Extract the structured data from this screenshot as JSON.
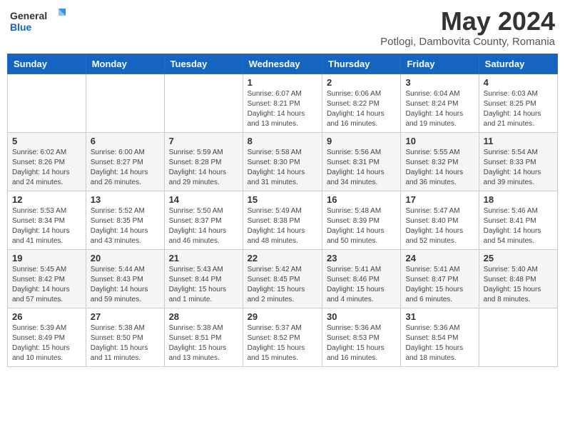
{
  "header": {
    "logo_general": "General",
    "logo_blue": "Blue",
    "month_title": "May 2024",
    "subtitle": "Potlogi, Dambovita County, Romania"
  },
  "weekdays": [
    "Sunday",
    "Monday",
    "Tuesday",
    "Wednesday",
    "Thursday",
    "Friday",
    "Saturday"
  ],
  "weeks": [
    [
      {
        "day": "",
        "detail": ""
      },
      {
        "day": "",
        "detail": ""
      },
      {
        "day": "",
        "detail": ""
      },
      {
        "day": "1",
        "detail": "Sunrise: 6:07 AM\nSunset: 8:21 PM\nDaylight: 14 hours\nand 13 minutes."
      },
      {
        "day": "2",
        "detail": "Sunrise: 6:06 AM\nSunset: 8:22 PM\nDaylight: 14 hours\nand 16 minutes."
      },
      {
        "day": "3",
        "detail": "Sunrise: 6:04 AM\nSunset: 8:24 PM\nDaylight: 14 hours\nand 19 minutes."
      },
      {
        "day": "4",
        "detail": "Sunrise: 6:03 AM\nSunset: 8:25 PM\nDaylight: 14 hours\nand 21 minutes."
      }
    ],
    [
      {
        "day": "5",
        "detail": "Sunrise: 6:02 AM\nSunset: 8:26 PM\nDaylight: 14 hours\nand 24 minutes."
      },
      {
        "day": "6",
        "detail": "Sunrise: 6:00 AM\nSunset: 8:27 PM\nDaylight: 14 hours\nand 26 minutes."
      },
      {
        "day": "7",
        "detail": "Sunrise: 5:59 AM\nSunset: 8:28 PM\nDaylight: 14 hours\nand 29 minutes."
      },
      {
        "day": "8",
        "detail": "Sunrise: 5:58 AM\nSunset: 8:30 PM\nDaylight: 14 hours\nand 31 minutes."
      },
      {
        "day": "9",
        "detail": "Sunrise: 5:56 AM\nSunset: 8:31 PM\nDaylight: 14 hours\nand 34 minutes."
      },
      {
        "day": "10",
        "detail": "Sunrise: 5:55 AM\nSunset: 8:32 PM\nDaylight: 14 hours\nand 36 minutes."
      },
      {
        "day": "11",
        "detail": "Sunrise: 5:54 AM\nSunset: 8:33 PM\nDaylight: 14 hours\nand 39 minutes."
      }
    ],
    [
      {
        "day": "12",
        "detail": "Sunrise: 5:53 AM\nSunset: 8:34 PM\nDaylight: 14 hours\nand 41 minutes."
      },
      {
        "day": "13",
        "detail": "Sunrise: 5:52 AM\nSunset: 8:35 PM\nDaylight: 14 hours\nand 43 minutes."
      },
      {
        "day": "14",
        "detail": "Sunrise: 5:50 AM\nSunset: 8:37 PM\nDaylight: 14 hours\nand 46 minutes."
      },
      {
        "day": "15",
        "detail": "Sunrise: 5:49 AM\nSunset: 8:38 PM\nDaylight: 14 hours\nand 48 minutes."
      },
      {
        "day": "16",
        "detail": "Sunrise: 5:48 AM\nSunset: 8:39 PM\nDaylight: 14 hours\nand 50 minutes."
      },
      {
        "day": "17",
        "detail": "Sunrise: 5:47 AM\nSunset: 8:40 PM\nDaylight: 14 hours\nand 52 minutes."
      },
      {
        "day": "18",
        "detail": "Sunrise: 5:46 AM\nSunset: 8:41 PM\nDaylight: 14 hours\nand 54 minutes."
      }
    ],
    [
      {
        "day": "19",
        "detail": "Sunrise: 5:45 AM\nSunset: 8:42 PM\nDaylight: 14 hours\nand 57 minutes."
      },
      {
        "day": "20",
        "detail": "Sunrise: 5:44 AM\nSunset: 8:43 PM\nDaylight: 14 hours\nand 59 minutes."
      },
      {
        "day": "21",
        "detail": "Sunrise: 5:43 AM\nSunset: 8:44 PM\nDaylight: 15 hours\nand 1 minute."
      },
      {
        "day": "22",
        "detail": "Sunrise: 5:42 AM\nSunset: 8:45 PM\nDaylight: 15 hours\nand 2 minutes."
      },
      {
        "day": "23",
        "detail": "Sunrise: 5:41 AM\nSunset: 8:46 PM\nDaylight: 15 hours\nand 4 minutes."
      },
      {
        "day": "24",
        "detail": "Sunrise: 5:41 AM\nSunset: 8:47 PM\nDaylight: 15 hours\nand 6 minutes."
      },
      {
        "day": "25",
        "detail": "Sunrise: 5:40 AM\nSunset: 8:48 PM\nDaylight: 15 hours\nand 8 minutes."
      }
    ],
    [
      {
        "day": "26",
        "detail": "Sunrise: 5:39 AM\nSunset: 8:49 PM\nDaylight: 15 hours\nand 10 minutes."
      },
      {
        "day": "27",
        "detail": "Sunrise: 5:38 AM\nSunset: 8:50 PM\nDaylight: 15 hours\nand 11 minutes."
      },
      {
        "day": "28",
        "detail": "Sunrise: 5:38 AM\nSunset: 8:51 PM\nDaylight: 15 hours\nand 13 minutes."
      },
      {
        "day": "29",
        "detail": "Sunrise: 5:37 AM\nSunset: 8:52 PM\nDaylight: 15 hours\nand 15 minutes."
      },
      {
        "day": "30",
        "detail": "Sunrise: 5:36 AM\nSunset: 8:53 PM\nDaylight: 15 hours\nand 16 minutes."
      },
      {
        "day": "31",
        "detail": "Sunrise: 5:36 AM\nSunset: 8:54 PM\nDaylight: 15 hours\nand 18 minutes."
      },
      {
        "day": "",
        "detail": ""
      }
    ]
  ]
}
